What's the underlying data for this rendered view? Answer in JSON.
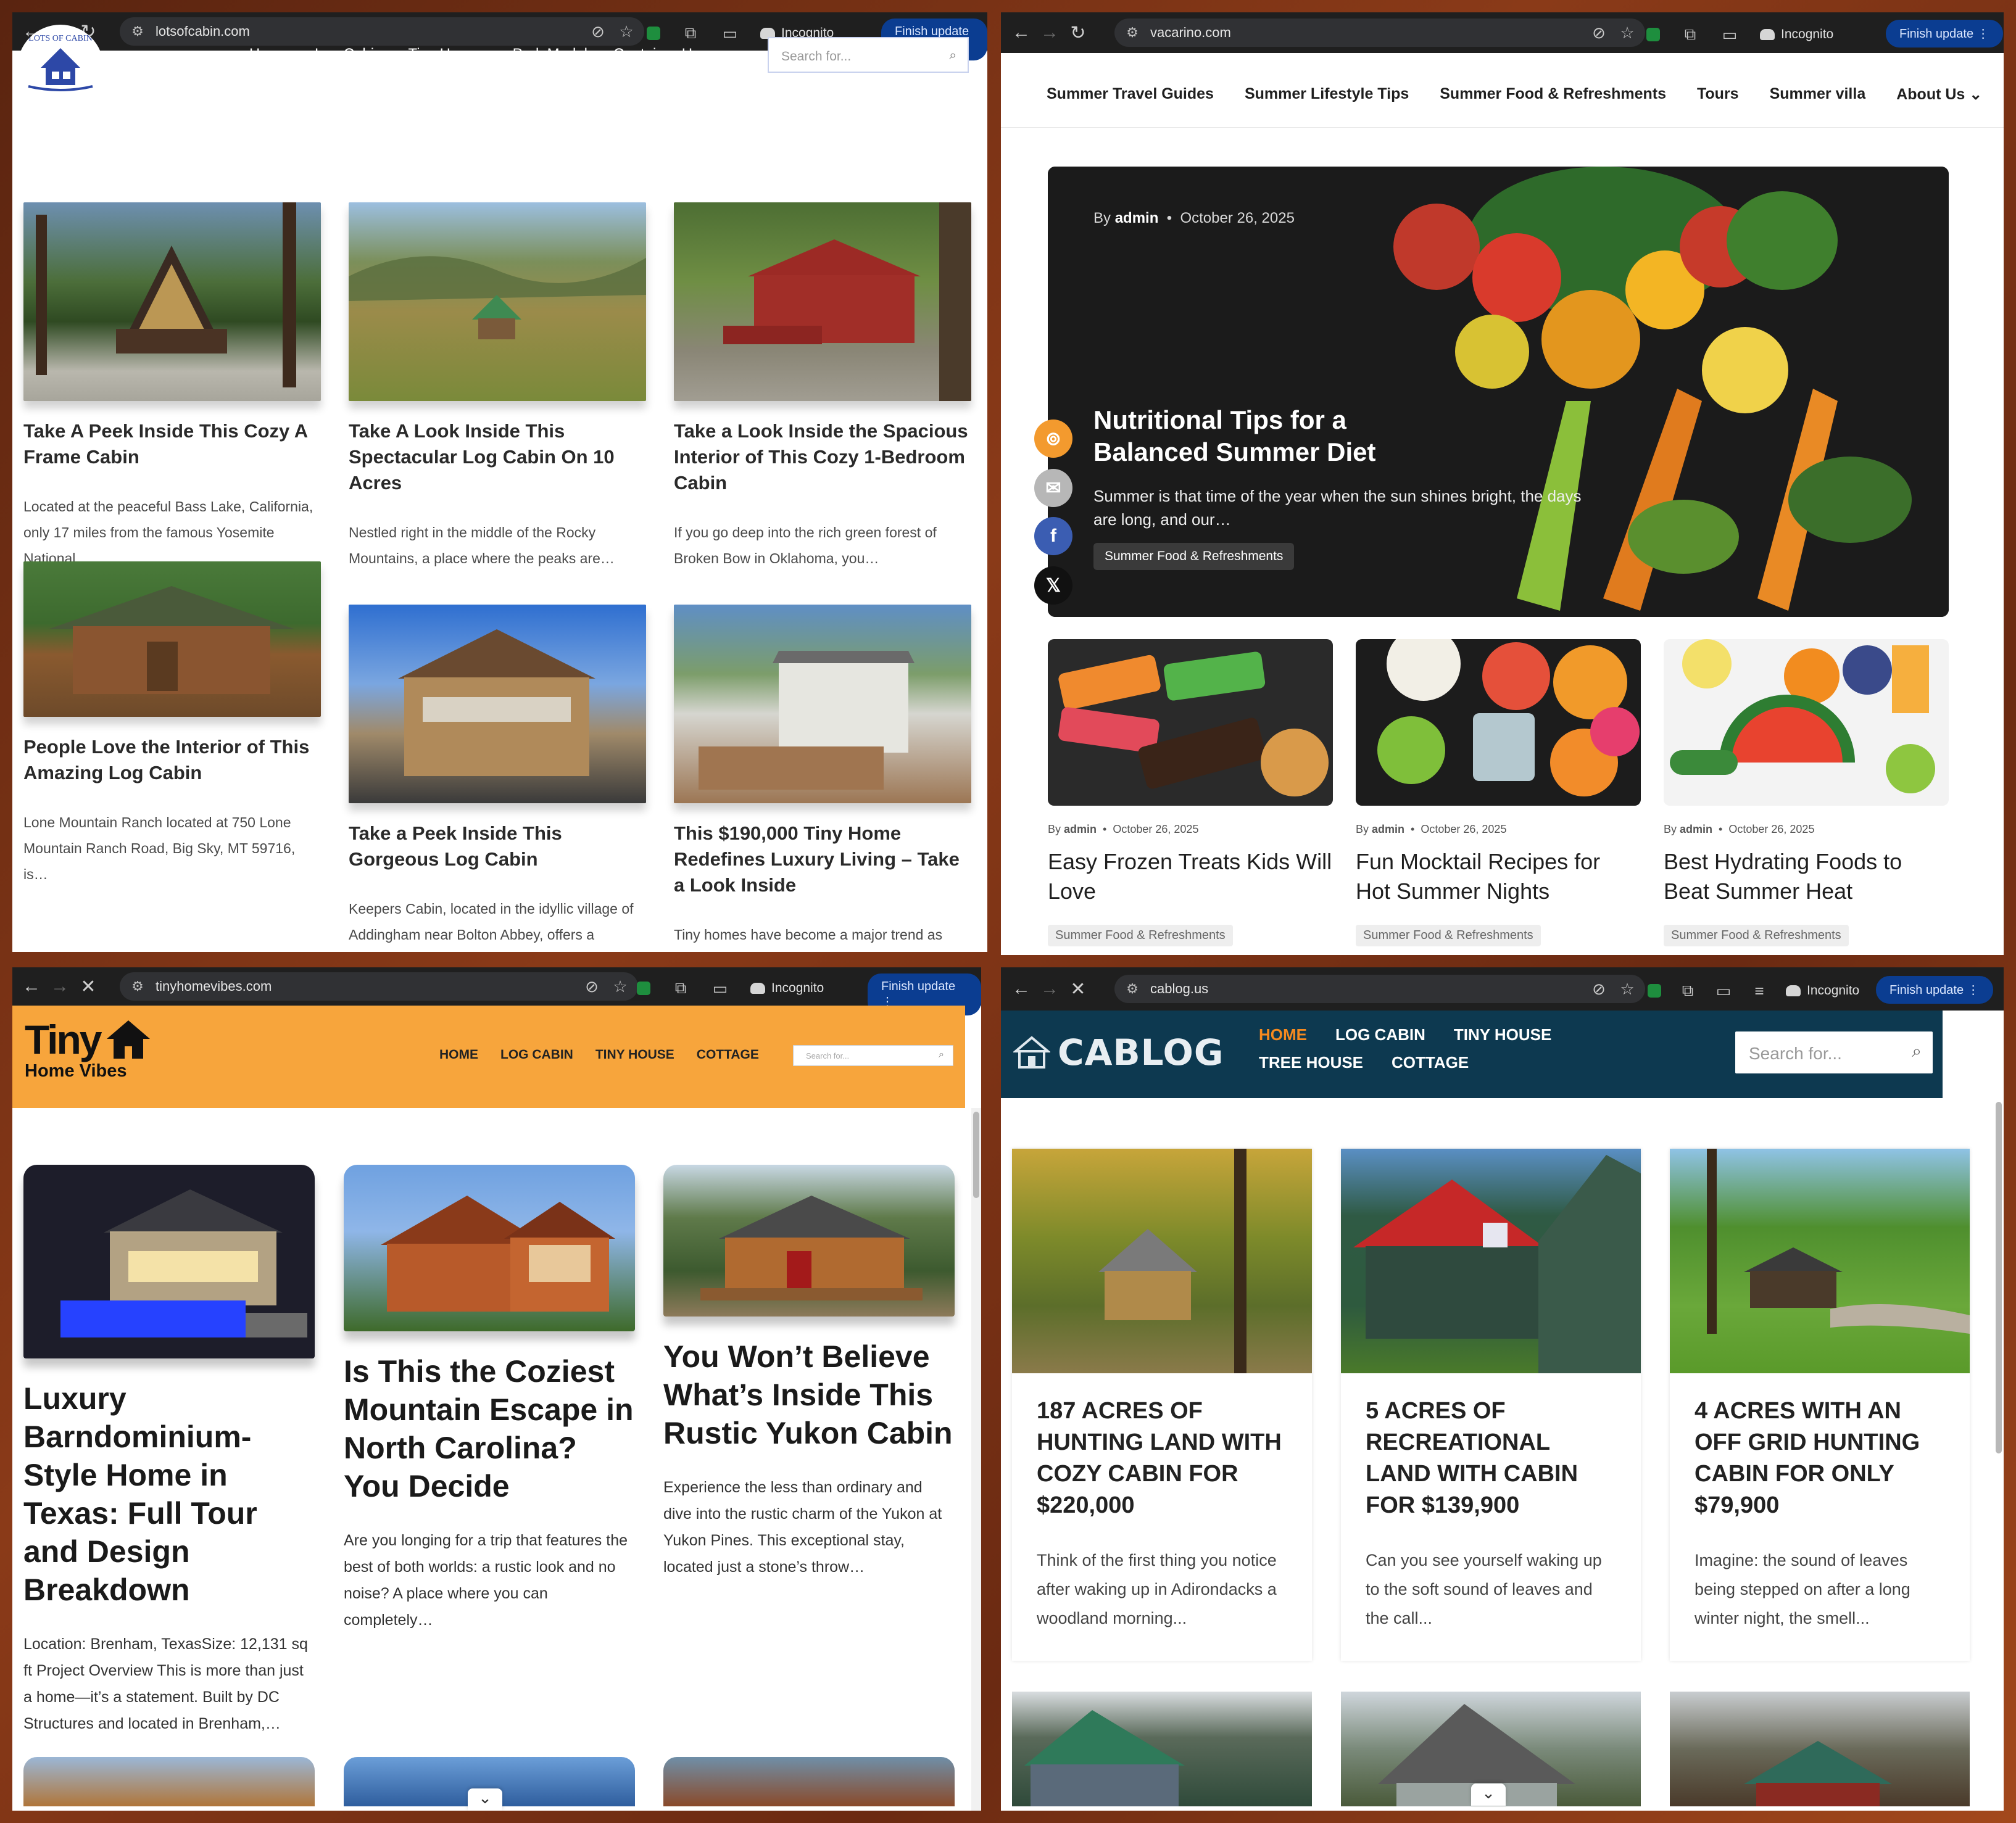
{
  "browser": {
    "incognito_label": "Incognito",
    "finish_update_label": "Finish update"
  },
  "w1": {
    "url": "lotsofcabin.com",
    "logo_text": "LOTS OF CABIN",
    "nav": [
      "Home",
      "Log Cabin",
      "Tiny Homes",
      "Park Model",
      "Container Homes"
    ],
    "search_placeholder": "Search for...",
    "posts": [
      {
        "title": "Take A Peek Inside This Cozy A Frame Cabin",
        "excerpt": "Located at the peaceful Bass Lake, California, only 17 miles from the famous Yosemite National…"
      },
      {
        "title": "Take A Look Inside This Spectacular Log Cabin On 10 Acres",
        "excerpt": "Nestled right in the middle of the Rocky Mountains, a place where the peaks are…"
      },
      {
        "title": "Take a Look Inside the Spacious Interior of This Cozy 1-Bedroom Cabin",
        "excerpt": "If you go deep into the rich green forest of Broken Bow in Oklahoma, you…"
      },
      {
        "title": "People Love the Interior of This Amazing Log Cabin",
        "excerpt": "Lone Mountain Ranch located at 750 Lone Mountain Ranch Road, Big Sky, MT 59716, is…"
      },
      {
        "title": "Take a Peek Inside This Gorgeous Log Cabin",
        "excerpt": "Keepers Cabin, located in the idyllic village of Addingham near Bolton Abbey, offers a"
      },
      {
        "title": "This $190,000 Tiny Home Redefines Luxury Living – Take a Look Inside",
        "excerpt": "Tiny homes have become a major trend as"
      }
    ]
  },
  "w2": {
    "url": "vacarino.com",
    "nav": [
      "Summer Travel Guides",
      "Summer Lifestyle Tips",
      "Summer Food & Refreshments",
      "Tours",
      "Summer villa",
      "About Us"
    ],
    "hero": {
      "by": "By",
      "author": "admin",
      "date": "October 26, 2025",
      "title": "Nutritional Tips for a Balanced Summer Diet",
      "excerpt": "Summer is that time of the year when the sun shines bright, the days are long, and our…",
      "category": "Summer Food & Refreshments"
    },
    "social": [
      "rss-icon",
      "email-icon",
      "facebook-icon",
      "x-icon"
    ],
    "posts": [
      {
        "by": "By",
        "author": "admin",
        "date": "October 26, 2025",
        "title": "Easy Frozen Treats Kids Will Love",
        "category": "Summer Food & Refreshments"
      },
      {
        "by": "By",
        "author": "admin",
        "date": "October 26, 2025",
        "title": "Fun Mocktail Recipes for Hot Summer Nights",
        "category": "Summer Food & Refreshments"
      },
      {
        "by": "By",
        "author": "admin",
        "date": "October 26, 2025",
        "title": "Best Hydrating Foods to Beat Summer Heat",
        "category": "Summer Food & Refreshments"
      }
    ]
  },
  "w3": {
    "url": "tinyhomevibes.com",
    "logo_top": "Tiny",
    "logo_bottom": "Home Vibes",
    "nav": [
      "HOME",
      "LOG CABIN",
      "TINY HOUSE",
      "COTTAGE"
    ],
    "search_placeholder": "Search for...",
    "posts": [
      {
        "title": "Luxury Barndominium-Style Home in Texas: Full Tour and Design Breakdown",
        "excerpt": "Location: Brenham, TexasSize: 12,131 sq ft Project Overview This is more than just a home—it’s a statement. Built by DC Structures and located in Brenham,…"
      },
      {
        "title": "Is This the Coziest Mountain Escape in North Carolina? You Decide",
        "excerpt": "Are you longing for a trip that features the best of both worlds: a rustic look and no noise? A place where you can completely…"
      },
      {
        "title": "You Won’t Believe What’s Inside This Rustic Yukon Cabin",
        "excerpt": "Experience the less than ordinary and dive into the rustic charm of the Yukon at Yukon Pines. This exceptional stay, located just a stone’s throw…"
      }
    ]
  },
  "w4": {
    "url": "cablog.us",
    "logo_text": "CABLOG",
    "nav": [
      "HOME",
      "LOG CABIN",
      "TINY HOUSE",
      "TREE HOUSE",
      "COTTAGE"
    ],
    "search_placeholder": "Search for...",
    "posts": [
      {
        "title": "187 ACRES OF HUNTING LAND WITH COZY CABIN FOR $220,000",
        "excerpt": "Think of the first thing you notice after waking up in Adirondacks a woodland morning..."
      },
      {
        "title": "5 ACRES OF RECREATIONAL LAND WITH CABIN FOR $139,900",
        "excerpt": "Can you see yourself waking up to the soft sound of leaves and the call..."
      },
      {
        "title": "4 ACRES WITH AN OFF GRID HUNTING CABIN FOR ONLY $79,900",
        "excerpt": "Imagine: the sound of leaves being stepped on after a long winter night, the smell..."
      }
    ]
  },
  "colors": {
    "w1_header": "#2d48a7",
    "w3_header": "#f7a53c",
    "w4_header": "#0d3950",
    "w4_active_nav": "#f58a1f"
  }
}
